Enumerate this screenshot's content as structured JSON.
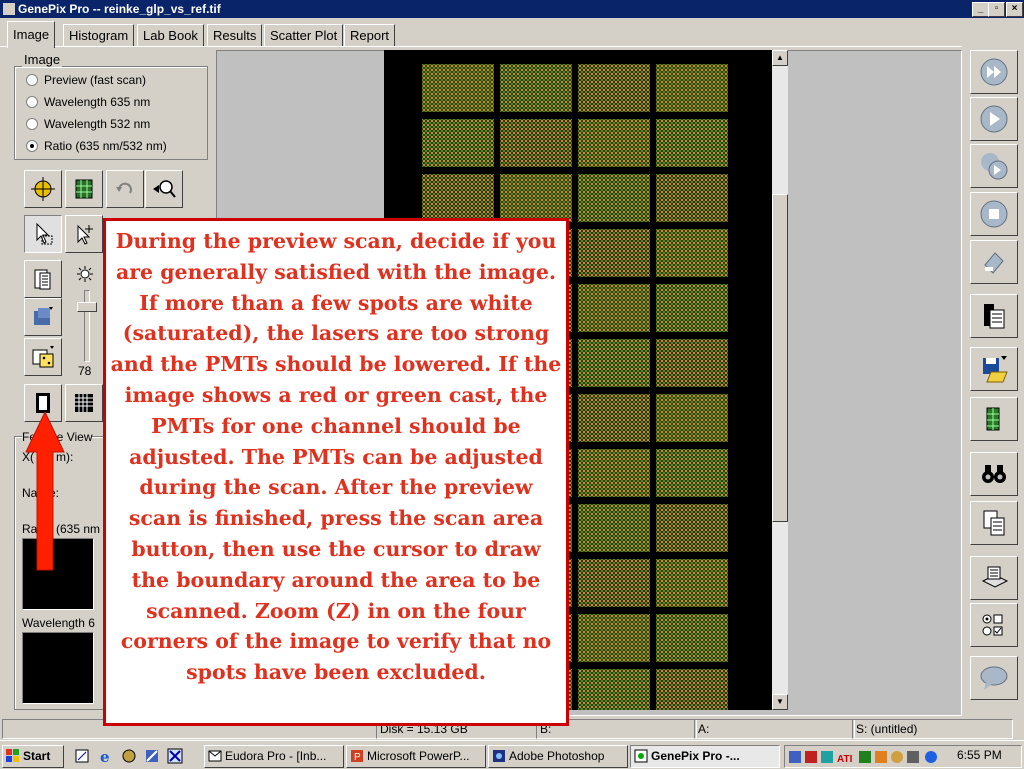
{
  "window": {
    "title": "GenePix Pro -- reinke_glp_vs_ref.tif"
  },
  "tabs": [
    "Image",
    "Histogram",
    "Lab Book",
    "Results",
    "Scatter Plot",
    "Report"
  ],
  "image_group": {
    "label": "Image",
    "options": [
      "Preview  (fast scan)",
      "Wavelength 635 nm",
      "Wavelength 532 nm",
      "Ratio (635 nm/532 nm)"
    ],
    "selected": "Ratio (635 nm/532 nm)"
  },
  "brightness_value": "78",
  "feature_viewer": {
    "label": "Feature View",
    "x_label": "X(",
    "x_unit": "m):",
    "name_label": "Na",
    "name_suffix": "e:",
    "ratio_label": "Ra",
    "ratio_suffix": "(635 nm",
    "wavelength_label": "Wavelength 6"
  },
  "annotation": {
    "text": "During the preview scan, decide if you are generally satisfied with the image.  If more than a few spots are white (saturated), the lasers are too strong and the PMTs should be lowered. If the image shows a red or green cast, the PMTs for one channel should be adjusted.  The PMTs can be adjusted during the scan. After the preview scan is finished, press the scan area button, then use the cursor to draw the boundary around the area to be scanned.   Zoom (Z) in on the four corners of the image to verify that no spots have been excluded.",
    "color": "#e0301e",
    "border_color": "#cc0000"
  },
  "status_bar": {
    "disk": "Disk = 15.13 GB",
    "b": "B:",
    "a": "A:",
    "s": "S: (untitled)"
  },
  "taskbar": {
    "start": "Start",
    "items": [
      "Eudora Pro - [Inb...",
      "Microsoft PowerP...",
      "Adobe Photoshop",
      "GenePix Pro -..."
    ],
    "active": "GenePix Pro -...",
    "clock": "6:55 PM"
  },
  "colors": {
    "title_bar": "#0a246a",
    "face": "#d4d0c8",
    "desktop_panel": "#c0c0c0"
  }
}
